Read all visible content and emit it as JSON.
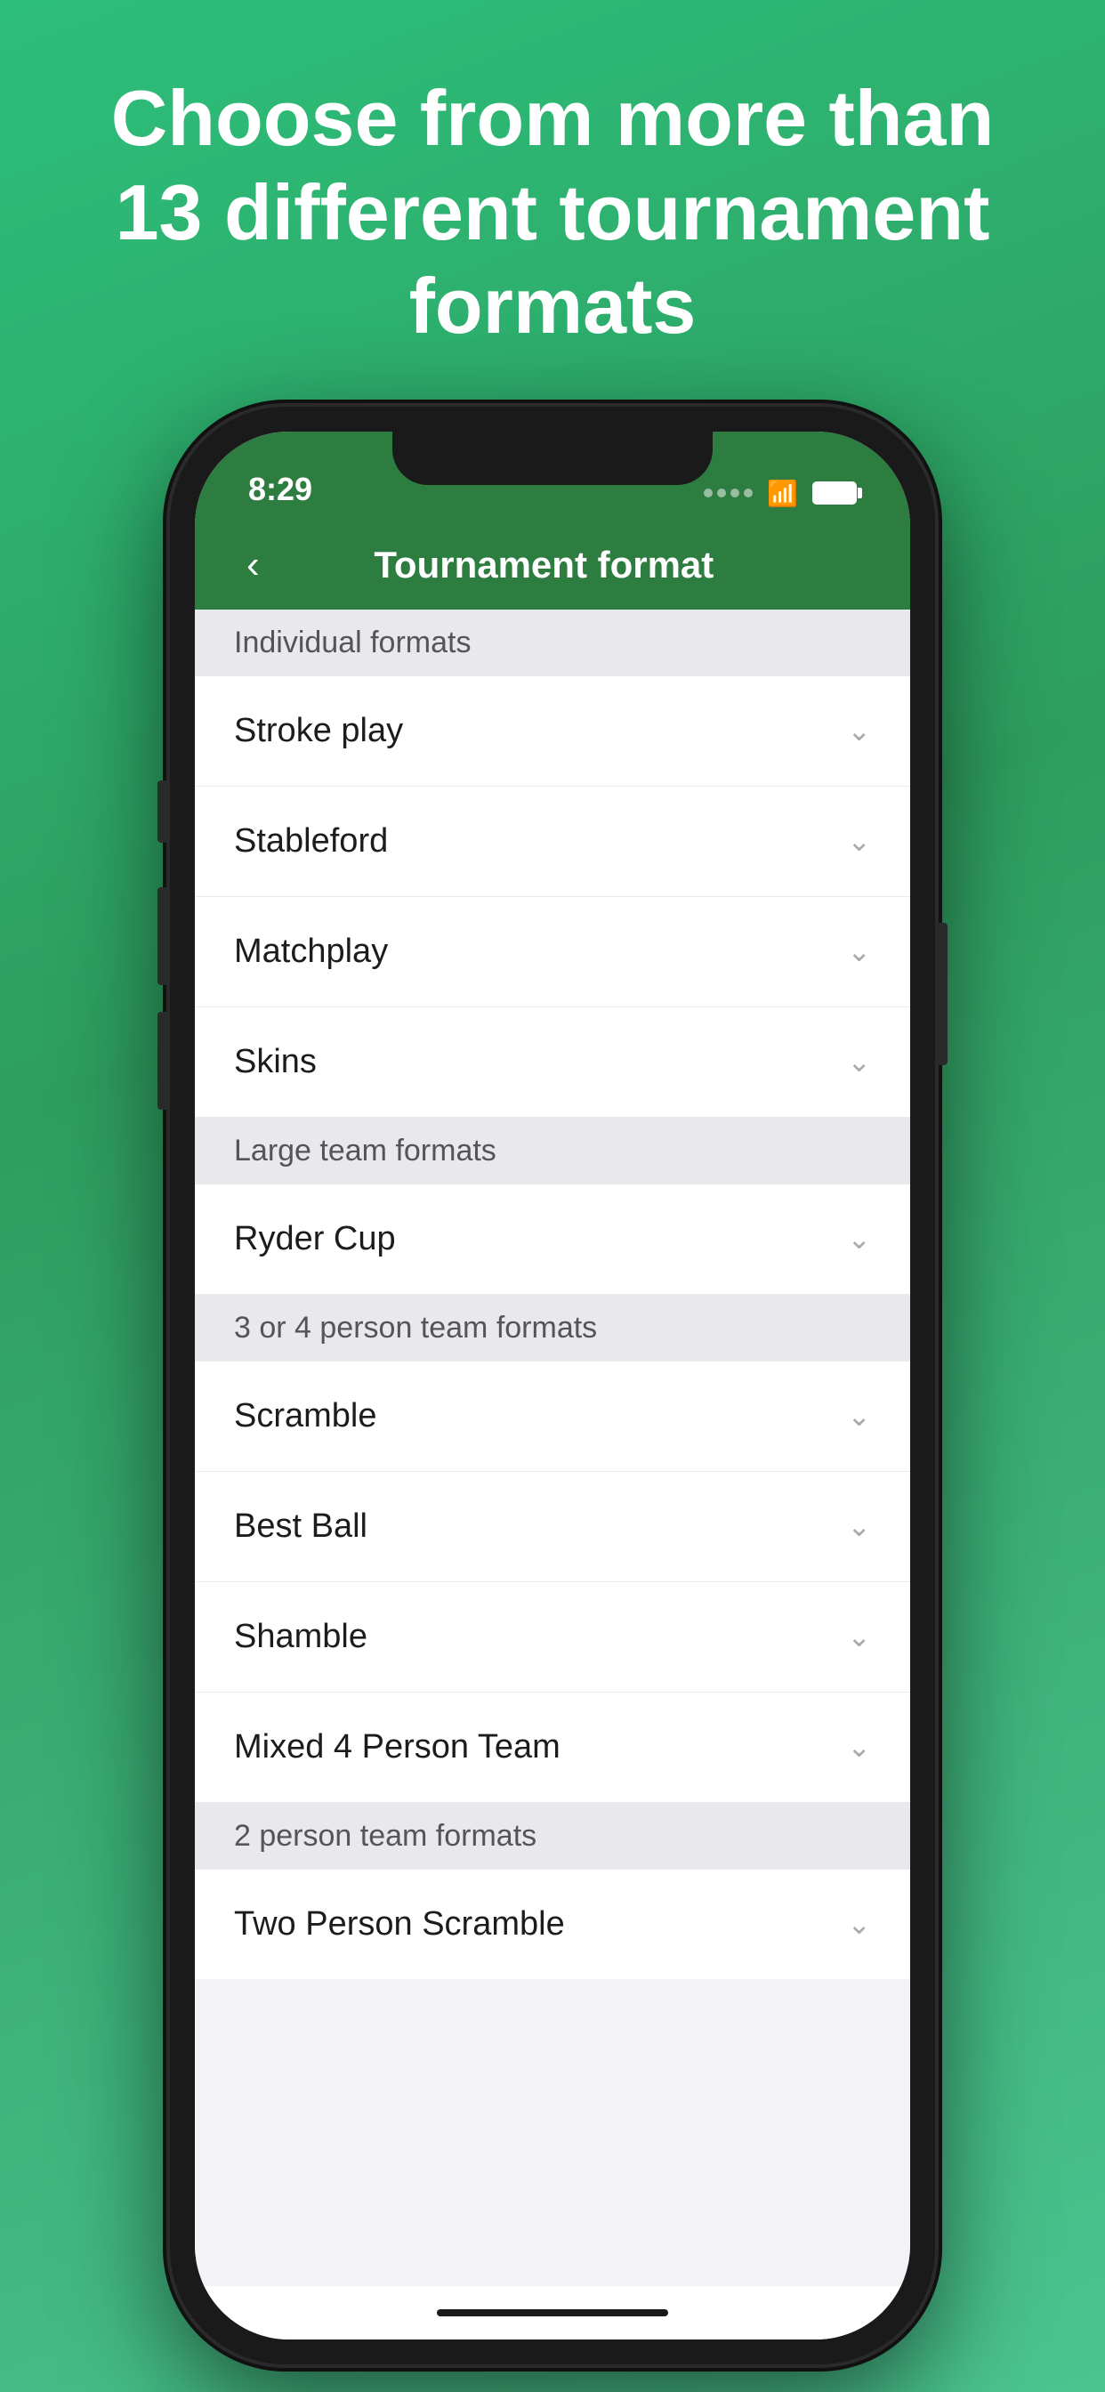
{
  "hero": {
    "text": "Choose from more than 13 different tournament formats"
  },
  "statusBar": {
    "time": "8:29"
  },
  "navBar": {
    "backLabel": "‹",
    "title": "Tournament format"
  },
  "sections": [
    {
      "id": "individual-formats",
      "header": "Individual formats",
      "items": [
        {
          "id": "stroke-play",
          "label": "Stroke play"
        },
        {
          "id": "stableford",
          "label": "Stableford"
        },
        {
          "id": "matchplay",
          "label": "Matchplay"
        },
        {
          "id": "skins",
          "label": "Skins"
        }
      ]
    },
    {
      "id": "large-team-formats",
      "header": "Large team formats",
      "items": [
        {
          "id": "ryder-cup",
          "label": "Ryder Cup"
        }
      ]
    },
    {
      "id": "3-or-4-person-team-formats",
      "header": "3 or 4 person team formats",
      "items": [
        {
          "id": "scramble",
          "label": "Scramble"
        },
        {
          "id": "best-ball",
          "label": "Best Ball"
        },
        {
          "id": "shamble",
          "label": "Shamble"
        },
        {
          "id": "mixed-4-person-team",
          "label": "Mixed 4 Person Team"
        }
      ]
    },
    {
      "id": "2-person-team-formats",
      "header": "2 person team formats",
      "items": [
        {
          "id": "two-person-scramble",
          "label": "Two Person Scramble"
        }
      ]
    }
  ]
}
